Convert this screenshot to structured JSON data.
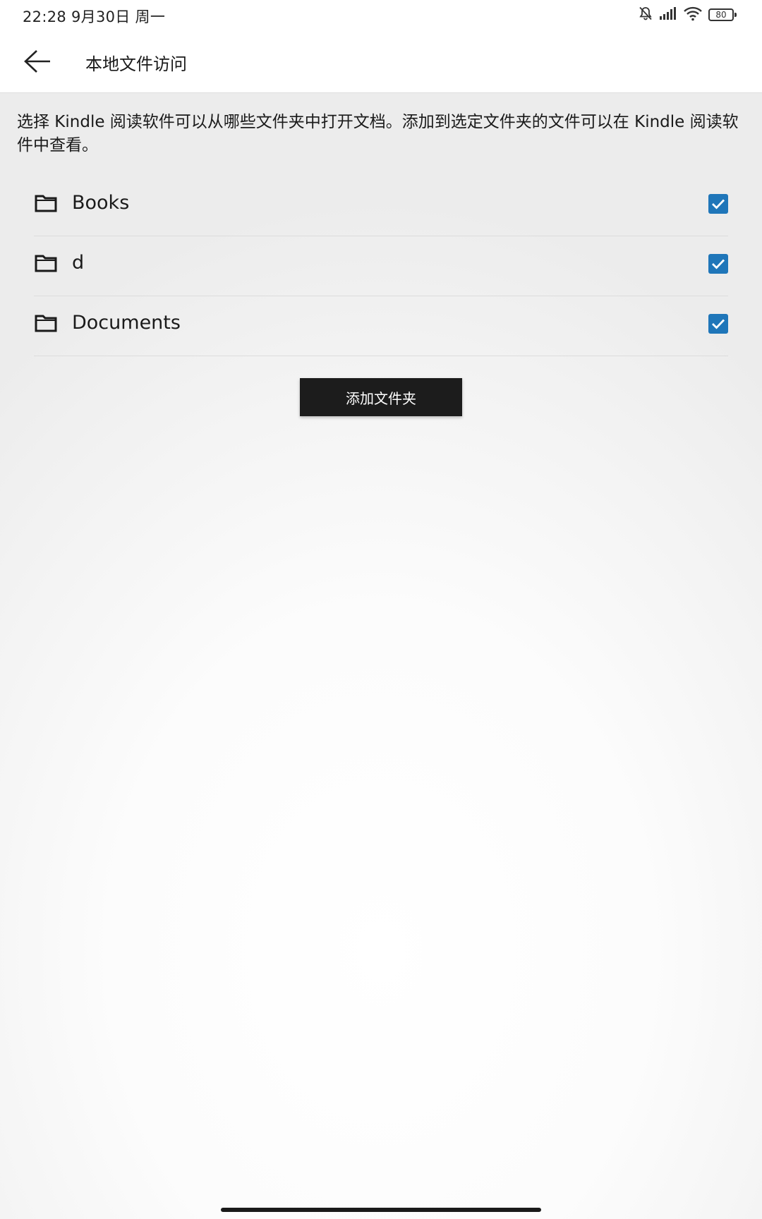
{
  "status_bar": {
    "time": "22:28  9月30日 周一",
    "battery_level": "80",
    "icons": [
      "bell-muted-icon",
      "signal-icon",
      "wifi-icon",
      "battery-icon"
    ]
  },
  "header": {
    "back_icon": "arrow-left-icon",
    "title": "本地文件访问"
  },
  "description": "选择 Kindle 阅读软件可以从哪些文件夹中打开文档。添加到选定文件夹的文件可以在 Kindle 阅读软件中查看。",
  "folders": [
    {
      "name": "Books",
      "checked": true
    },
    {
      "name": "d",
      "checked": true
    },
    {
      "name": "Documents",
      "checked": true
    }
  ],
  "add_folder_label": "添加文件夹",
  "colors": {
    "checkbox": "#1f76b9",
    "button": "#1c1c1c"
  }
}
